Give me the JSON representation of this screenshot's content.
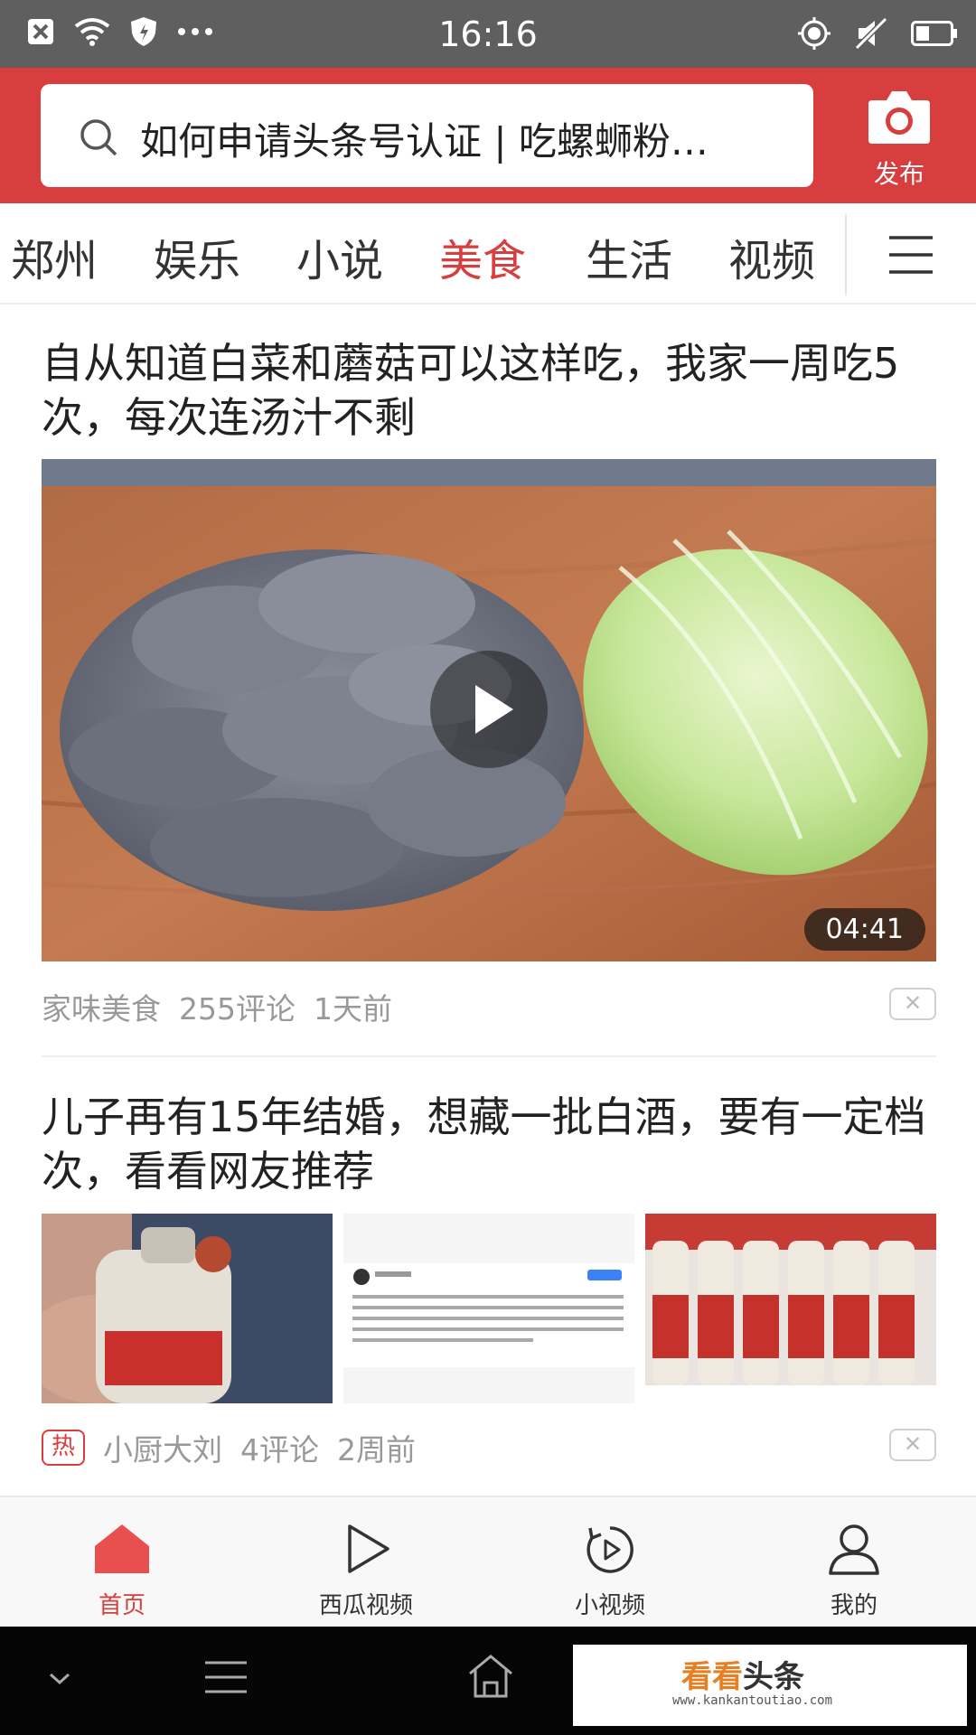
{
  "status_bar": {
    "time": "16:16"
  },
  "header": {
    "search_text": "如何申请头条号认证 | 吃螺蛳粉…",
    "publish_label": "发布"
  },
  "tabs": [
    {
      "label": "郑州"
    },
    {
      "label": "娱乐"
    },
    {
      "label": "小说"
    },
    {
      "label": "美食",
      "active": true
    },
    {
      "label": "生活"
    },
    {
      "label": "视频"
    }
  ],
  "articles": [
    {
      "title": "自从知道白菜和蘑菇可以这样吃，我家一周吃5次，每次连汤汁不剩",
      "duration": "04:41",
      "source": "家味美食",
      "comments": "255评论",
      "time": "1天前"
    },
    {
      "title": "儿子再有15年结婚，想藏一批白酒，要有一定档次，看看网友推荐",
      "hot_label": "热",
      "source": "小厨大刘",
      "comments": "4评论",
      "time": "2周前"
    }
  ],
  "bottom_tabs": [
    {
      "label": "首页",
      "icon": "home-icon",
      "active": true
    },
    {
      "label": "西瓜视频",
      "icon": "play-icon"
    },
    {
      "label": "小视频",
      "icon": "short-video-icon"
    },
    {
      "label": "我的",
      "icon": "profile-icon"
    }
  ],
  "watermark": {
    "brand_part1": "看看",
    "brand_part2": "头条",
    "url": "www.kankantoutiao.com"
  },
  "colors": {
    "accent": "#d93e3e",
    "header_bg": "#d93e3e",
    "status_bg": "#5f5f5f"
  }
}
